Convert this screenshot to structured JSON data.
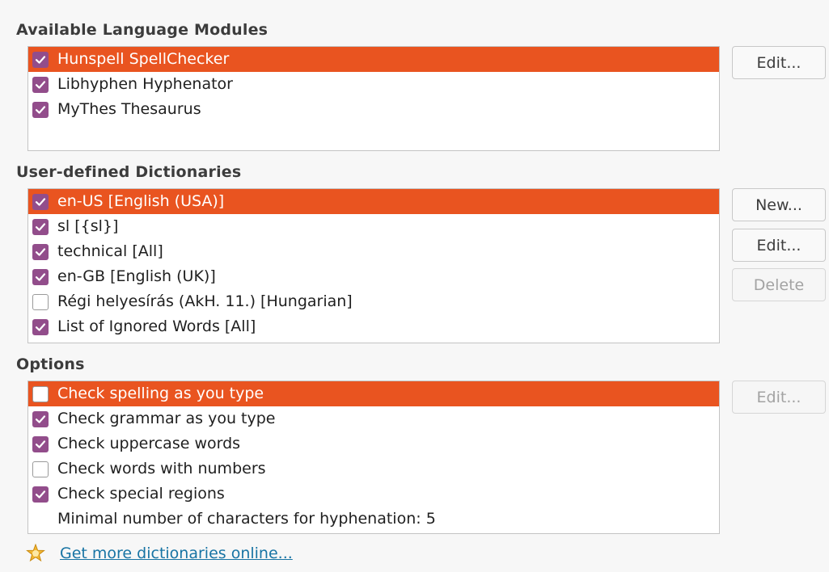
{
  "modules": {
    "title": "Available Language Modules",
    "items": [
      {
        "label": "Hunspell SpellChecker",
        "checked": true,
        "selected": true
      },
      {
        "label": "Libhyphen Hyphenator",
        "checked": true,
        "selected": false
      },
      {
        "label": "MyThes Thesaurus",
        "checked": true,
        "selected": false
      }
    ],
    "edit_button": "Edit..."
  },
  "dictionaries": {
    "title": "User-defined Dictionaries",
    "items": [
      {
        "label": "en-US [English (USA)]",
        "checked": true,
        "selected": true
      },
      {
        "label": "sl [{sl}]",
        "checked": true,
        "selected": false
      },
      {
        "label": "technical [All]",
        "checked": true,
        "selected": false
      },
      {
        "label": "en-GB [English (UK)]",
        "checked": true,
        "selected": false
      },
      {
        "label": "Régi helyesírás (AkH. 11.) [Hungarian]",
        "checked": false,
        "selected": false
      },
      {
        "label": "List of Ignored Words [All]",
        "checked": true,
        "selected": false
      }
    ],
    "new_button": "New...",
    "edit_button": "Edit...",
    "delete_button": "Delete"
  },
  "options": {
    "title": "Options",
    "items": [
      {
        "label": "Check spelling as you type",
        "checked": false,
        "selected": true
      },
      {
        "label": "Check grammar as you type",
        "checked": true,
        "selected": false
      },
      {
        "label": "Check uppercase words",
        "checked": true,
        "selected": false
      },
      {
        "label": "Check words with numbers",
        "checked": false,
        "selected": false
      },
      {
        "label": "Check special regions",
        "checked": true,
        "selected": false
      }
    ],
    "min_chars_label": "Minimal number of characters for hyphenation:  5",
    "edit_button": "Edit..."
  },
  "footer": {
    "link": "Get more dictionaries online...",
    "icon": "star-icon"
  },
  "colors": {
    "selection": "#e95420",
    "checkbox": "#924d8b",
    "link": "#1874a4"
  }
}
